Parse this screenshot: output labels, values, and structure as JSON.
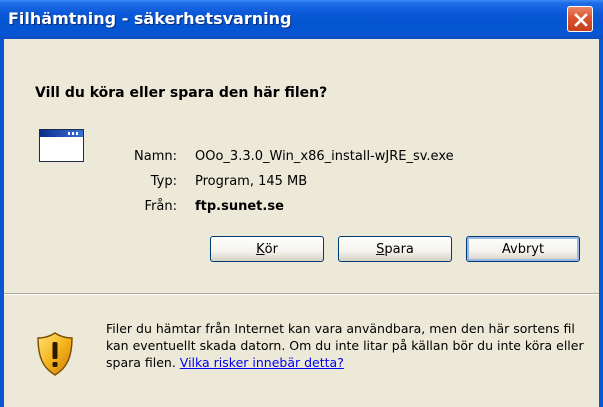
{
  "window": {
    "title": "Filhämtning - säkerhetsvarning",
    "title_bar_color": "#0554d0",
    "close_button_color": "#d9542c"
  },
  "question": "Vill du köra eller spara den här filen?",
  "file": {
    "icon": "program-window-icon",
    "name_label": "Namn:",
    "name_value": "OOo_3.3.0_Win_x86_install-wJRE_sv.exe",
    "type_label": "Typ:",
    "type_value": "Program, 145 MB",
    "from_label": "Från:",
    "from_value": "ftp.sunet.se"
  },
  "buttons": {
    "run": {
      "mnemonic": "K",
      "rest": "ör"
    },
    "save": {
      "mnemonic": "S",
      "rest": "para"
    },
    "cancel": {
      "label": "Avbryt"
    }
  },
  "warning": {
    "icon": "security-shield-warning-icon",
    "text": "Filer du hämtar från Internet kan vara användbara, men den här sortens fil kan eventuellt skada datorn. Om du inte litar på källan bör du inte köra eller spara filen. ",
    "link": "Vilka risker innebär detta?"
  }
}
